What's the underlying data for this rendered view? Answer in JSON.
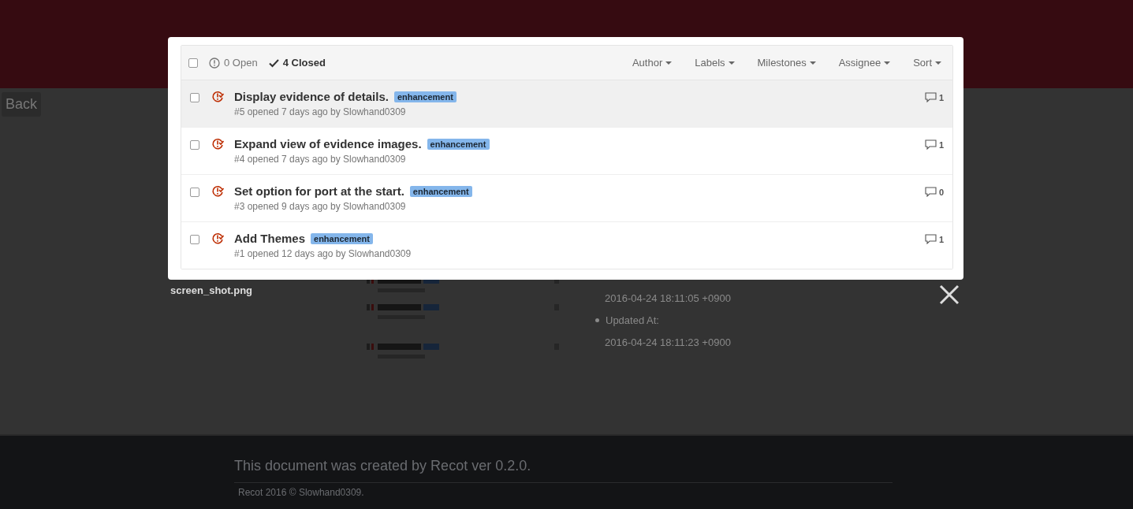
{
  "back_button": "Back",
  "details": [
    {
      "kind": "value",
      "text": "2016-04-24 18:11:05 +0900"
    },
    {
      "kind": "bullet",
      "text": "Updated At:"
    },
    {
      "kind": "value",
      "text": "2016-04-24 18:11:23 +0900"
    }
  ],
  "footer": {
    "text": "This document was created by Recot ver 0.2.0.",
    "copyright": "Recot 2016 © Slowhand0309."
  },
  "lightbox": {
    "caption": "screen_shot.png",
    "issues_panel": {
      "select_all_checked": false,
      "states": [
        {
          "kind": "open",
          "label": "0 Open",
          "selected": false
        },
        {
          "kind": "closed",
          "label": "4 Closed",
          "selected": true
        }
      ],
      "filters": [
        "Author",
        "Labels",
        "Milestones",
        "Assignee",
        "Sort"
      ],
      "issues": [
        {
          "title": "Display evidence of details.",
          "label": "enhancement",
          "meta": "#5 opened 7 days ago by Slowhand0309",
          "comments": "1",
          "checked": false,
          "selected": true
        },
        {
          "title": "Expand view of evidence images.",
          "label": "enhancement",
          "meta": "#4 opened 7 days ago by Slowhand0309",
          "comments": "1",
          "checked": false,
          "selected": false
        },
        {
          "title": "Set option for port at the start.",
          "label": "enhancement",
          "meta": "#3 opened 9 days ago by Slowhand0309",
          "comments": "0",
          "checked": false,
          "selected": false
        },
        {
          "title": "Add Themes",
          "label": "enhancement",
          "meta": "#1 opened 12 days ago by Slowhand0309",
          "comments": "1",
          "checked": false,
          "selected": false
        }
      ]
    }
  }
}
